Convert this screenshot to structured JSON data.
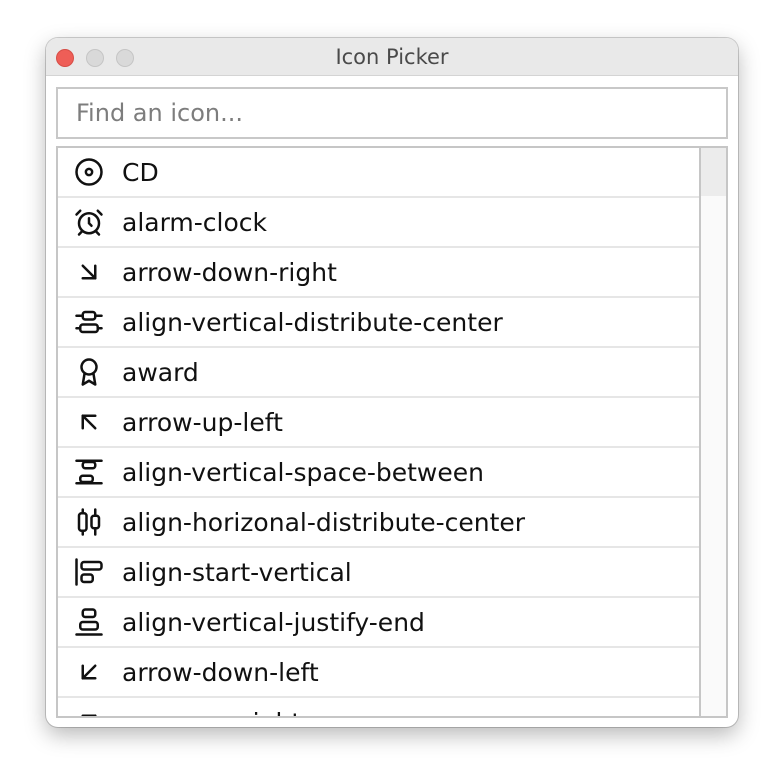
{
  "window": {
    "title": "Icon Picker"
  },
  "search": {
    "placeholder": "Find an icon...",
    "value": ""
  },
  "icons": [
    {
      "label": "CD",
      "icon": "disc-icon"
    },
    {
      "label": "alarm-clock",
      "icon": "alarm-clock-icon"
    },
    {
      "label": "arrow-down-right",
      "icon": "arrow-down-right-icon"
    },
    {
      "label": "align-vertical-distribute-center",
      "icon": "align-vertical-distribute-center-icon"
    },
    {
      "label": "award",
      "icon": "award-icon"
    },
    {
      "label": "arrow-up-left",
      "icon": "arrow-up-left-icon"
    },
    {
      "label": "align-vertical-space-between",
      "icon": "align-vertical-space-between-icon"
    },
    {
      "label": "align-horizonal-distribute-center",
      "icon": "align-horizontal-distribute-center-icon"
    },
    {
      "label": "align-start-vertical",
      "icon": "align-start-vertical-icon"
    },
    {
      "label": "align-vertical-justify-end",
      "icon": "align-vertical-justify-end-icon"
    },
    {
      "label": "arrow-down-left",
      "icon": "arrow-down-left-icon"
    },
    {
      "label": "arrow-up-right",
      "icon": "arrow-up-right-icon"
    }
  ],
  "colors": {
    "close": "#ee5e57",
    "inactive_traffic": "#d9d9d9",
    "titlebar": "#e9e9e9"
  }
}
